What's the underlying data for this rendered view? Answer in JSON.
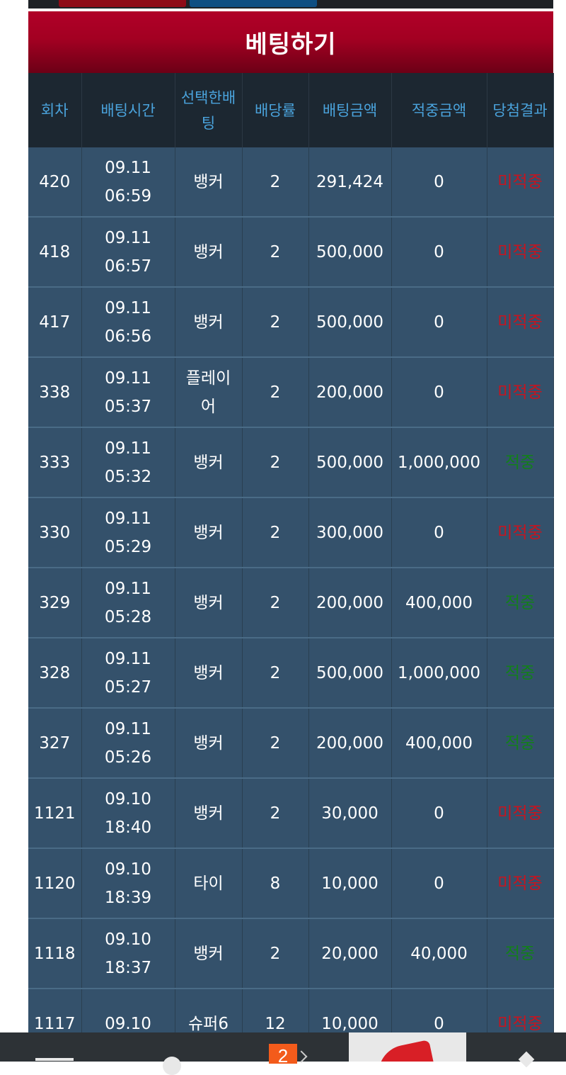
{
  "header": {
    "title": "베팅하기"
  },
  "columns": [
    "회차",
    "배팅시간",
    "선택한배팅",
    "배당률",
    "배팅금액",
    "적중금액",
    "당첨결과"
  ],
  "rows": [
    {
      "round": "420",
      "date": "09.11",
      "time": "06:59",
      "pick": "뱅커",
      "odds": "2",
      "bet": "291,424",
      "win": "0",
      "result": "미적중",
      "status": "lose"
    },
    {
      "round": "418",
      "date": "09.11",
      "time": "06:57",
      "pick": "뱅커",
      "odds": "2",
      "bet": "500,000",
      "win": "0",
      "result": "미적중",
      "status": "lose"
    },
    {
      "round": "417",
      "date": "09.11",
      "time": "06:56",
      "pick": "뱅커",
      "odds": "2",
      "bet": "500,000",
      "win": "0",
      "result": "미적중",
      "status": "lose"
    },
    {
      "round": "338",
      "date": "09.11",
      "time": "05:37",
      "pick": "플레이어",
      "odds": "2",
      "bet": "200,000",
      "win": "0",
      "result": "미적중",
      "status": "lose"
    },
    {
      "round": "333",
      "date": "09.11",
      "time": "05:32",
      "pick": "뱅커",
      "odds": "2",
      "bet": "500,000",
      "win": "1,000,000",
      "result": "적중",
      "status": "win"
    },
    {
      "round": "330",
      "date": "09.11",
      "time": "05:29",
      "pick": "뱅커",
      "odds": "2",
      "bet": "300,000",
      "win": "0",
      "result": "미적중",
      "status": "lose"
    },
    {
      "round": "329",
      "date": "09.11",
      "time": "05:28",
      "pick": "뱅커",
      "odds": "2",
      "bet": "200,000",
      "win": "400,000",
      "result": "적중",
      "status": "win"
    },
    {
      "round": "328",
      "date": "09.11",
      "time": "05:27",
      "pick": "뱅커",
      "odds": "2",
      "bet": "500,000",
      "win": "1,000,000",
      "result": "적중",
      "status": "win"
    },
    {
      "round": "327",
      "date": "09.11",
      "time": "05:26",
      "pick": "뱅커",
      "odds": "2",
      "bet": "200,000",
      "win": "400,000",
      "result": "적중",
      "status": "win"
    },
    {
      "round": "1121",
      "date": "09.10",
      "time": "18:40",
      "pick": "뱅커",
      "odds": "2",
      "bet": "30,000",
      "win": "0",
      "result": "미적중",
      "status": "lose"
    },
    {
      "round": "1120",
      "date": "09.10",
      "time": "18:39",
      "pick": "타이",
      "odds": "8",
      "bet": "10,000",
      "win": "0",
      "result": "미적중",
      "status": "lose"
    },
    {
      "round": "1118",
      "date": "09.10",
      "time": "18:37",
      "pick": "뱅커",
      "odds": "2",
      "bet": "20,000",
      "win": "40,000",
      "result": "적중",
      "status": "win"
    },
    {
      "round": "1117",
      "date": "09.10",
      "time": "",
      "pick": "슈퍼6",
      "odds": "12",
      "bet": "10,000",
      "win": "0",
      "result": "미적중",
      "status": "lose"
    }
  ],
  "navbar": {
    "badge_count": "2"
  },
  "colors": {
    "header_red": "#a30022",
    "row_bg": "#34516b",
    "header_text_blue": "#4aa3dc",
    "win_green": "#128019",
    "lose_red": "#c7141f"
  }
}
